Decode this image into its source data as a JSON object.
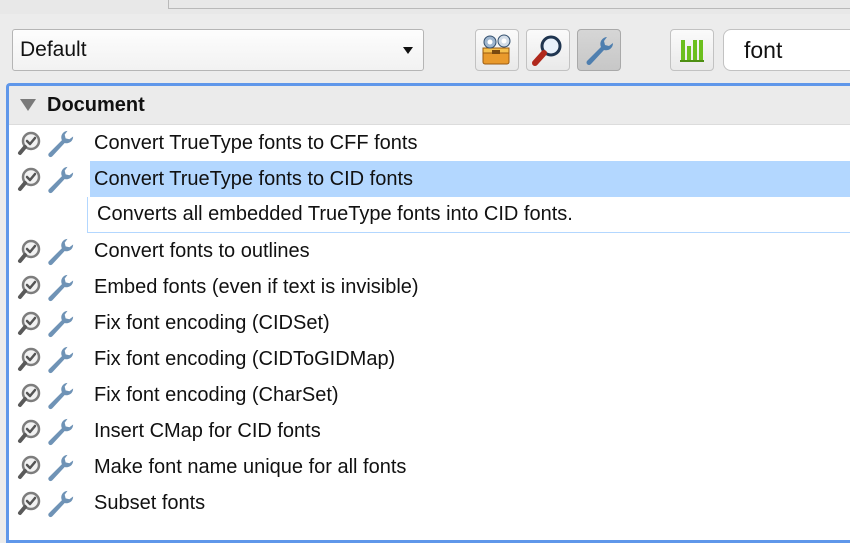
{
  "toolbar": {
    "profile_select": {
      "value": "Default"
    },
    "buttons": [
      {
        "name": "fixups-toolbox-button",
        "icon": "toolbox-wrench-icon"
      },
      {
        "name": "inspect-button",
        "icon": "magnifier-icon"
      },
      {
        "name": "fixups-filter-button",
        "icon": "wrench-icon",
        "active": true
      }
    ],
    "chart_button": {
      "icon": "bar-chart-icon"
    },
    "search": {
      "value": "font"
    }
  },
  "list": {
    "group": "Document",
    "items": [
      {
        "label": "Convert TrueType fonts to CFF fonts"
      },
      {
        "label": "Convert TrueType fonts to CID fonts",
        "selected": true,
        "description": "Converts all embedded TrueType fonts into CID fonts."
      },
      {
        "label": "Convert fonts to outlines"
      },
      {
        "label": "Embed fonts (even if text is invisible)"
      },
      {
        "label": "Fix font encoding (CIDSet)"
      },
      {
        "label": "Fix font encoding (CIDToGIDMap)"
      },
      {
        "label": "Fix font encoding (CharSet)"
      },
      {
        "label": "Insert CMap for CID fonts"
      },
      {
        "label": "Make font name unique for all fonts"
      },
      {
        "label": "Subset fonts"
      }
    ]
  },
  "colors": {
    "accent": "#5f97ea",
    "selection": "#b3d7ff",
    "wrench": "#6f93b6",
    "chart_green": "#6cbf1e"
  }
}
